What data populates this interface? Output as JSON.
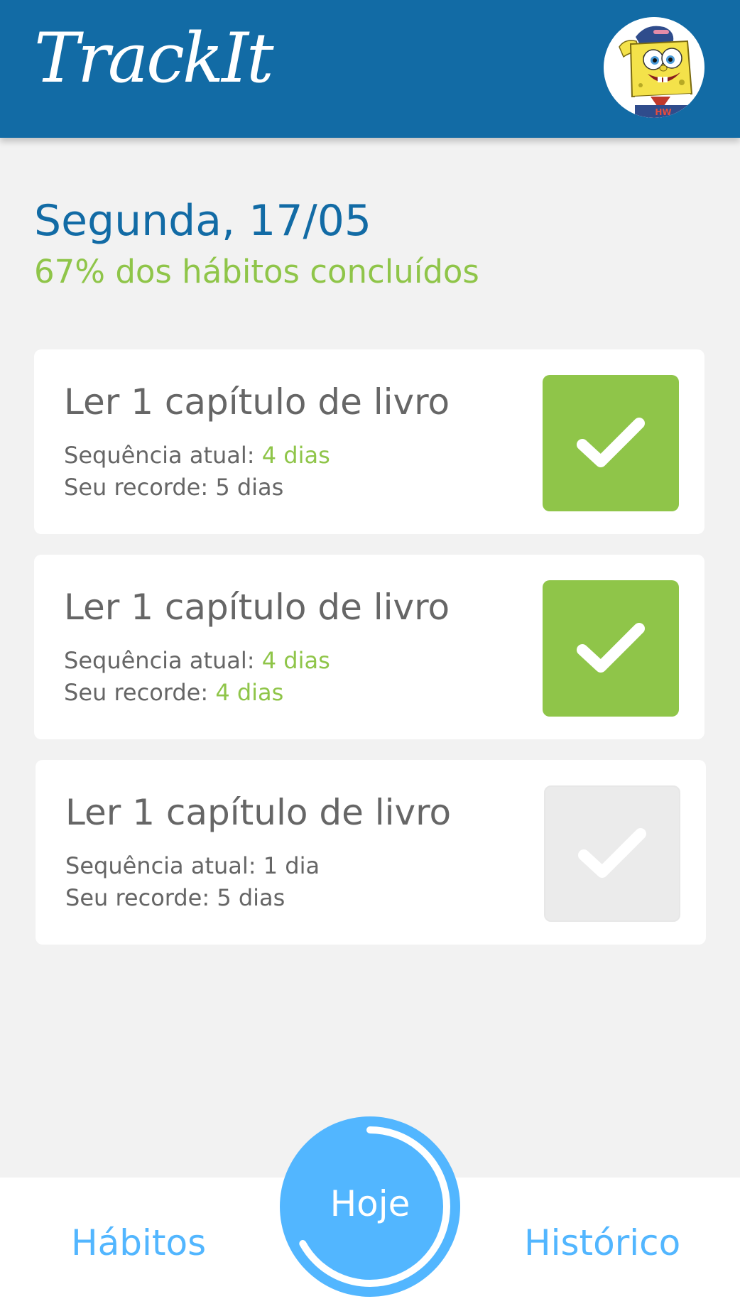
{
  "header": {
    "logo": "TrackIt",
    "avatar_icon": "spongebob-avatar"
  },
  "today": {
    "date_title": "Segunda, 17/05",
    "progress_text": "67% dos hábitos concluídos"
  },
  "habits": [
    {
      "name": "Ler 1 capítulo de livro",
      "current_label": "Sequência atual: ",
      "current_value": "4 dias",
      "record_label": "Seu recorde: ",
      "record_value": "5 dias",
      "done": true
    },
    {
      "name": "Ler 1 capítulo de livro",
      "current_label": "Sequência atual: ",
      "current_value": "4 dias",
      "record_label": "Seu recorde: ",
      "record_value": "4 dias",
      "done": true
    },
    {
      "name": "Ler 1 capítulo de livro",
      "current_label": "Sequência atual: ",
      "current_value": "1 dia",
      "record_label": "Seu recorde: ",
      "record_value": "5 dias",
      "done": false
    }
  ],
  "footer": {
    "habits_label": "Hábitos",
    "today_label": "Hoje",
    "history_label": "Histórico",
    "today_progress": 0.67
  },
  "colors": {
    "header": "#126BA5",
    "accent_green": "#8FC549",
    "accent_blue": "#52B6FF",
    "text_gray": "#666666",
    "background": "#F2F2F2"
  }
}
